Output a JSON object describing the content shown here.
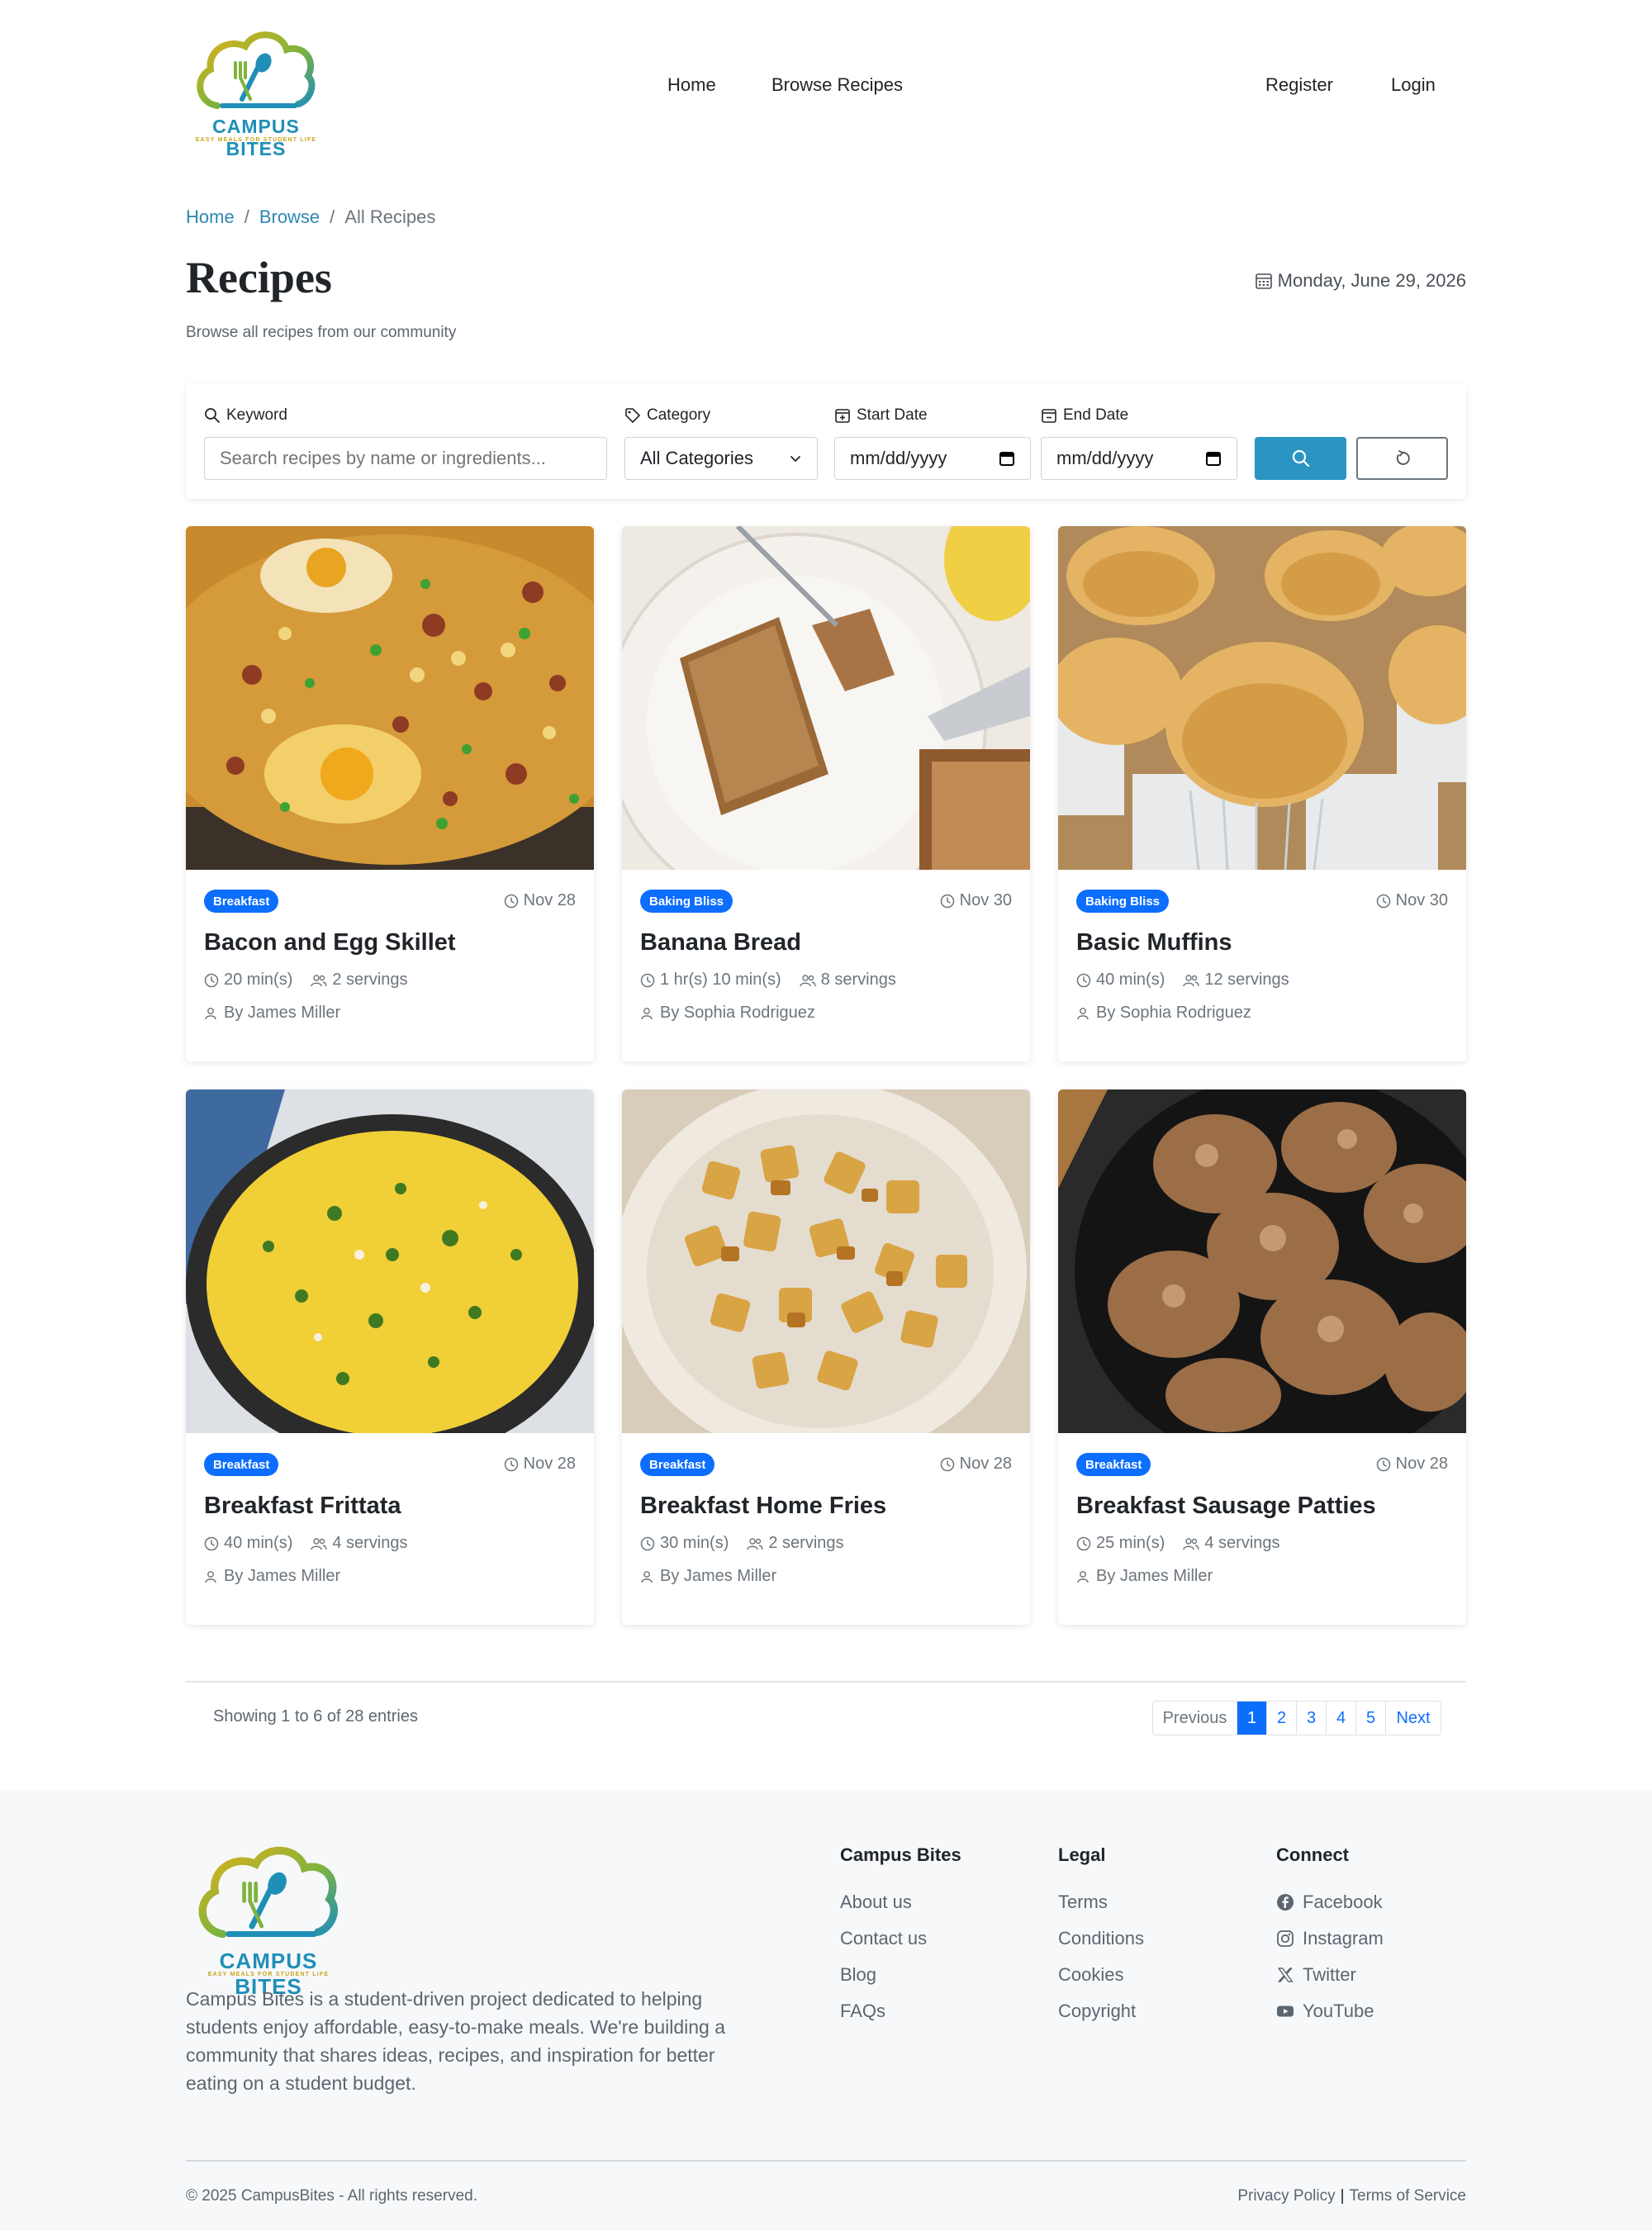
{
  "brand": {
    "name": "CAMPUS BITES",
    "tagline": "EASY MEALS FOR STUDENT LIFE"
  },
  "nav": {
    "home": "Home",
    "browse": "Browse Recipes",
    "register": "Register",
    "login": "Login"
  },
  "breadcrumb": [
    "Home",
    "Browse",
    "All Recipes"
  ],
  "page": {
    "title": "Recipes",
    "subtitle": "Browse all recipes from our community",
    "date": "Monday, June 29, 2026"
  },
  "filters": {
    "keyword_label": "Keyword",
    "keyword_placeholder": "Search recipes by name or ingredients...",
    "category_label": "Category",
    "category_value": "All Categories",
    "start_label": "Start Date",
    "start_value": "mm/dd/yyyy",
    "end_label": "End Date",
    "end_value": "mm/dd/yyyy"
  },
  "recipes": [
    {
      "badge": "Breakfast",
      "date": "Nov 28",
      "title": "Bacon and Egg Skillet",
      "time": "20 min(s)",
      "servings": "2 servings",
      "author": "By James Miller"
    },
    {
      "badge": "Baking Bliss",
      "date": "Nov 30",
      "title": "Banana Bread",
      "time": "1 hr(s) 10 min(s)",
      "servings": "8 servings",
      "author": "By Sophia Rodriguez"
    },
    {
      "badge": "Baking Bliss",
      "date": "Nov 30",
      "title": "Basic Muffins",
      "time": "40 min(s)",
      "servings": "12 servings",
      "author": "By Sophia Rodriguez"
    },
    {
      "badge": "Breakfast",
      "date": "Nov 28",
      "title": "Breakfast Frittata",
      "time": "40 min(s)",
      "servings": "4 servings",
      "author": "By James Miller"
    },
    {
      "badge": "Breakfast",
      "date": "Nov 28",
      "title": "Breakfast Home Fries",
      "time": "30 min(s)",
      "servings": "2 servings",
      "author": "By James Miller"
    },
    {
      "badge": "Breakfast",
      "date": "Nov 28",
      "title": "Breakfast Sausage Patties",
      "time": "25 min(s)",
      "servings": "4 servings",
      "author": "By James Miller"
    }
  ],
  "pagination": {
    "showing": "Showing 1 to 6 of 28 entries",
    "previous": "Previous",
    "pages": [
      "1",
      "2",
      "3",
      "4",
      "5"
    ],
    "next": "Next"
  },
  "footer": {
    "description": "Campus Bites is a student-driven project dedicated to helping students enjoy affordable, easy-to-make meals. We're building a community that shares ideas, recipes, and inspiration for better eating on a student budget.",
    "col1": {
      "title": "Campus Bites",
      "links": [
        "About us",
        "Contact us",
        "Blog",
        "FAQs"
      ]
    },
    "col2": {
      "title": "Legal",
      "links": [
        "Terms",
        "Conditions",
        "Cookies",
        "Copyright"
      ]
    },
    "col3": {
      "title": "Connect",
      "links": [
        "Facebook",
        "Instagram",
        "Twitter",
        "YouTube"
      ]
    },
    "copyright": "© 2025 CampusBites - All rights reserved.",
    "privacy": "Privacy Policy",
    "tos": "Terms of Service"
  },
  "colors": {
    "accent": "#2a95c2",
    "badge": "#0d6efd",
    "brand_teal": "#1f8fb8",
    "brand_gold": "#c9a318"
  }
}
